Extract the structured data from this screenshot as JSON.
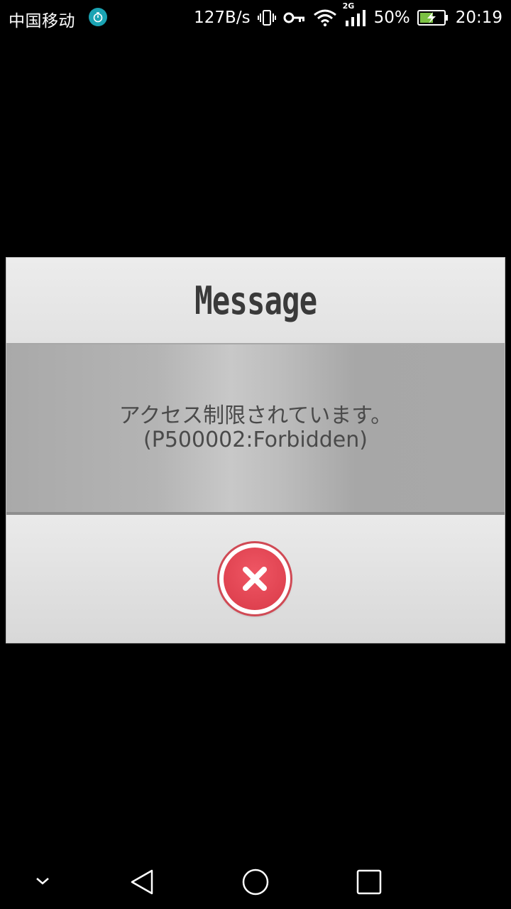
{
  "status_bar": {
    "carrier": "中国移动",
    "net_speed": "127B/s",
    "network_type": "2G",
    "battery": "50%",
    "time": "20:19",
    "icons": [
      "stopwatch-icon",
      "vibrate-icon",
      "key-icon",
      "wifi-icon",
      "signal-icon",
      "battery-charging-icon"
    ]
  },
  "dialog": {
    "title": "Message",
    "message_line1": "アクセス制限されています。",
    "message_line2": "(P500002:Forbidden)",
    "close_icon": "close-x-icon",
    "accent_color": "#e04452"
  },
  "navigation": {
    "icons": [
      "chevron-down-icon",
      "back-icon",
      "home-icon",
      "recents-icon"
    ]
  }
}
